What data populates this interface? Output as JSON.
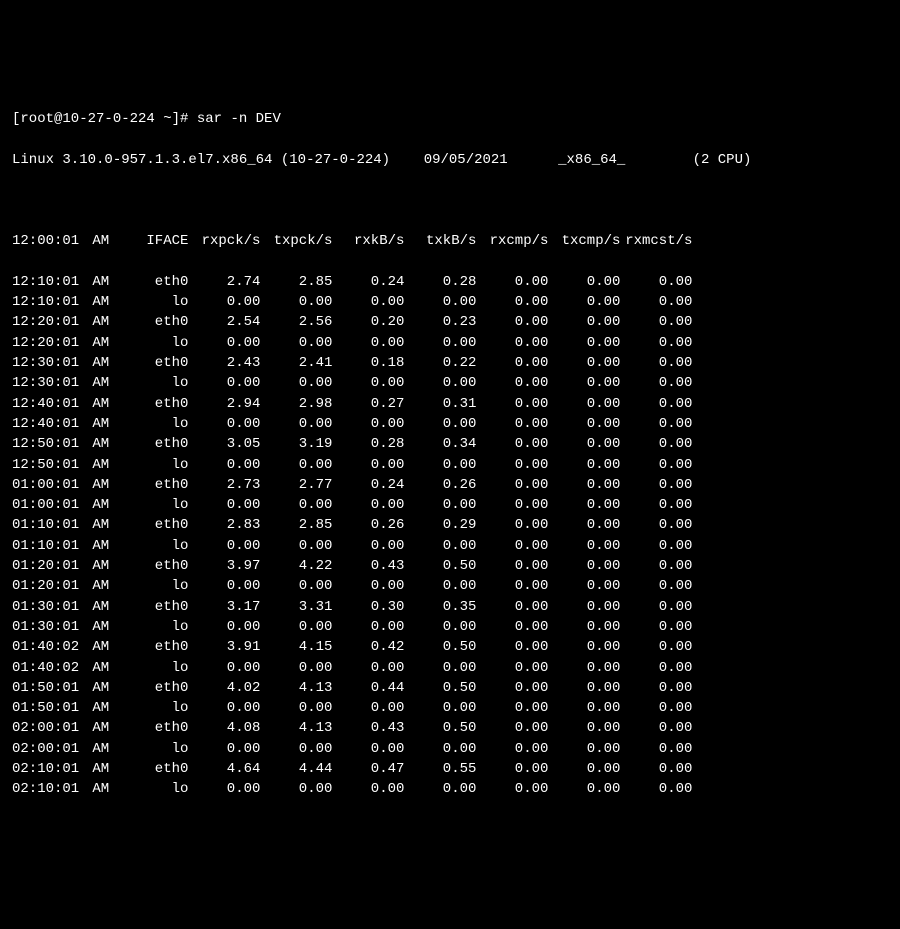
{
  "prompt": "[root@10-27-0-224 ~]# ",
  "command": "sar -n DEV",
  "sysinfo": {
    "kernel": "Linux 3.10.0-957.1.3.el7.x86_64",
    "host": "(10-27-0-224)",
    "date": "09/05/2021",
    "arch": "_x86_64_",
    "cpus": "(2 CPU)"
  },
  "header": {
    "time": "12:00:01 AM",
    "iface": "IFACE",
    "rxpck": "rxpck/s",
    "txpck": "txpck/s",
    "rxkb": "rxkB/s",
    "txkb": "txkB/s",
    "rxcmp": "rxcmp/s",
    "txcmp": "txcmp/s",
    "rxmcst": "rxmcst/s"
  },
  "rows": [
    {
      "time": "12:10:01",
      "ampm": "AM",
      "iface": "eth0",
      "rxpck": "2.74",
      "txpck": "2.85",
      "rxkb": "0.24",
      "txkb": "0.28",
      "rxcmp": "0.00",
      "txcmp": "0.00",
      "rxmcst": "0.00"
    },
    {
      "time": "12:10:01",
      "ampm": "AM",
      "iface": "lo",
      "rxpck": "0.00",
      "txpck": "0.00",
      "rxkb": "0.00",
      "txkb": "0.00",
      "rxcmp": "0.00",
      "txcmp": "0.00",
      "rxmcst": "0.00"
    },
    {
      "time": "12:20:01",
      "ampm": "AM",
      "iface": "eth0",
      "rxpck": "2.54",
      "txpck": "2.56",
      "rxkb": "0.20",
      "txkb": "0.23",
      "rxcmp": "0.00",
      "txcmp": "0.00",
      "rxmcst": "0.00"
    },
    {
      "time": "12:20:01",
      "ampm": "AM",
      "iface": "lo",
      "rxpck": "0.00",
      "txpck": "0.00",
      "rxkb": "0.00",
      "txkb": "0.00",
      "rxcmp": "0.00",
      "txcmp": "0.00",
      "rxmcst": "0.00"
    },
    {
      "time": "12:30:01",
      "ampm": "AM",
      "iface": "eth0",
      "rxpck": "2.43",
      "txpck": "2.41",
      "rxkb": "0.18",
      "txkb": "0.22",
      "rxcmp": "0.00",
      "txcmp": "0.00",
      "rxmcst": "0.00"
    },
    {
      "time": "12:30:01",
      "ampm": "AM",
      "iface": "lo",
      "rxpck": "0.00",
      "txpck": "0.00",
      "rxkb": "0.00",
      "txkb": "0.00",
      "rxcmp": "0.00",
      "txcmp": "0.00",
      "rxmcst": "0.00"
    },
    {
      "time": "12:40:01",
      "ampm": "AM",
      "iface": "eth0",
      "rxpck": "2.94",
      "txpck": "2.98",
      "rxkb": "0.27",
      "txkb": "0.31",
      "rxcmp": "0.00",
      "txcmp": "0.00",
      "rxmcst": "0.00"
    },
    {
      "time": "12:40:01",
      "ampm": "AM",
      "iface": "lo",
      "rxpck": "0.00",
      "txpck": "0.00",
      "rxkb": "0.00",
      "txkb": "0.00",
      "rxcmp": "0.00",
      "txcmp": "0.00",
      "rxmcst": "0.00"
    },
    {
      "time": "12:50:01",
      "ampm": "AM",
      "iface": "eth0",
      "rxpck": "3.05",
      "txpck": "3.19",
      "rxkb": "0.28",
      "txkb": "0.34",
      "rxcmp": "0.00",
      "txcmp": "0.00",
      "rxmcst": "0.00"
    },
    {
      "time": "12:50:01",
      "ampm": "AM",
      "iface": "lo",
      "rxpck": "0.00",
      "txpck": "0.00",
      "rxkb": "0.00",
      "txkb": "0.00",
      "rxcmp": "0.00",
      "txcmp": "0.00",
      "rxmcst": "0.00"
    },
    {
      "time": "01:00:01",
      "ampm": "AM",
      "iface": "eth0",
      "rxpck": "2.73",
      "txpck": "2.77",
      "rxkb": "0.24",
      "txkb": "0.26",
      "rxcmp": "0.00",
      "txcmp": "0.00",
      "rxmcst": "0.00"
    },
    {
      "time": "01:00:01",
      "ampm": "AM",
      "iface": "lo",
      "rxpck": "0.00",
      "txpck": "0.00",
      "rxkb": "0.00",
      "txkb": "0.00",
      "rxcmp": "0.00",
      "txcmp": "0.00",
      "rxmcst": "0.00"
    },
    {
      "time": "01:10:01",
      "ampm": "AM",
      "iface": "eth0",
      "rxpck": "2.83",
      "txpck": "2.85",
      "rxkb": "0.26",
      "txkb": "0.29",
      "rxcmp": "0.00",
      "txcmp": "0.00",
      "rxmcst": "0.00"
    },
    {
      "time": "01:10:01",
      "ampm": "AM",
      "iface": "lo",
      "rxpck": "0.00",
      "txpck": "0.00",
      "rxkb": "0.00",
      "txkb": "0.00",
      "rxcmp": "0.00",
      "txcmp": "0.00",
      "rxmcst": "0.00"
    },
    {
      "time": "01:20:01",
      "ampm": "AM",
      "iface": "eth0",
      "rxpck": "3.97",
      "txpck": "4.22",
      "rxkb": "0.43",
      "txkb": "0.50",
      "rxcmp": "0.00",
      "txcmp": "0.00",
      "rxmcst": "0.00"
    },
    {
      "time": "01:20:01",
      "ampm": "AM",
      "iface": "lo",
      "rxpck": "0.00",
      "txpck": "0.00",
      "rxkb": "0.00",
      "txkb": "0.00",
      "rxcmp": "0.00",
      "txcmp": "0.00",
      "rxmcst": "0.00"
    },
    {
      "time": "01:30:01",
      "ampm": "AM",
      "iface": "eth0",
      "rxpck": "3.17",
      "txpck": "3.31",
      "rxkb": "0.30",
      "txkb": "0.35",
      "rxcmp": "0.00",
      "txcmp": "0.00",
      "rxmcst": "0.00"
    },
    {
      "time": "01:30:01",
      "ampm": "AM",
      "iface": "lo",
      "rxpck": "0.00",
      "txpck": "0.00",
      "rxkb": "0.00",
      "txkb": "0.00",
      "rxcmp": "0.00",
      "txcmp": "0.00",
      "rxmcst": "0.00"
    },
    {
      "time": "01:40:02",
      "ampm": "AM",
      "iface": "eth0",
      "rxpck": "3.91",
      "txpck": "4.15",
      "rxkb": "0.42",
      "txkb": "0.50",
      "rxcmp": "0.00",
      "txcmp": "0.00",
      "rxmcst": "0.00"
    },
    {
      "time": "01:40:02",
      "ampm": "AM",
      "iface": "lo",
      "rxpck": "0.00",
      "txpck": "0.00",
      "rxkb": "0.00",
      "txkb": "0.00",
      "rxcmp": "0.00",
      "txcmp": "0.00",
      "rxmcst": "0.00"
    },
    {
      "time": "01:50:01",
      "ampm": "AM",
      "iface": "eth0",
      "rxpck": "4.02",
      "txpck": "4.13",
      "rxkb": "0.44",
      "txkb": "0.50",
      "rxcmp": "0.00",
      "txcmp": "0.00",
      "rxmcst": "0.00"
    },
    {
      "time": "01:50:01",
      "ampm": "AM",
      "iface": "lo",
      "rxpck": "0.00",
      "txpck": "0.00",
      "rxkb": "0.00",
      "txkb": "0.00",
      "rxcmp": "0.00",
      "txcmp": "0.00",
      "rxmcst": "0.00"
    },
    {
      "time": "02:00:01",
      "ampm": "AM",
      "iface": "eth0",
      "rxpck": "4.08",
      "txpck": "4.13",
      "rxkb": "0.43",
      "txkb": "0.50",
      "rxcmp": "0.00",
      "txcmp": "0.00",
      "rxmcst": "0.00"
    },
    {
      "time": "02:00:01",
      "ampm": "AM",
      "iface": "lo",
      "rxpck": "0.00",
      "txpck": "0.00",
      "rxkb": "0.00",
      "txkb": "0.00",
      "rxcmp": "0.00",
      "txcmp": "0.00",
      "rxmcst": "0.00"
    },
    {
      "time": "02:10:01",
      "ampm": "AM",
      "iface": "eth0",
      "rxpck": "4.64",
      "txpck": "4.44",
      "rxkb": "0.47",
      "txkb": "0.55",
      "rxcmp": "0.00",
      "txcmp": "0.00",
      "rxmcst": "0.00"
    },
    {
      "time": "02:10:01",
      "ampm": "AM",
      "iface": "lo",
      "rxpck": "0.00",
      "txpck": "0.00",
      "rxkb": "0.00",
      "txkb": "0.00",
      "rxcmp": "0.00",
      "txcmp": "0.00",
      "rxmcst": "0.00"
    }
  ]
}
